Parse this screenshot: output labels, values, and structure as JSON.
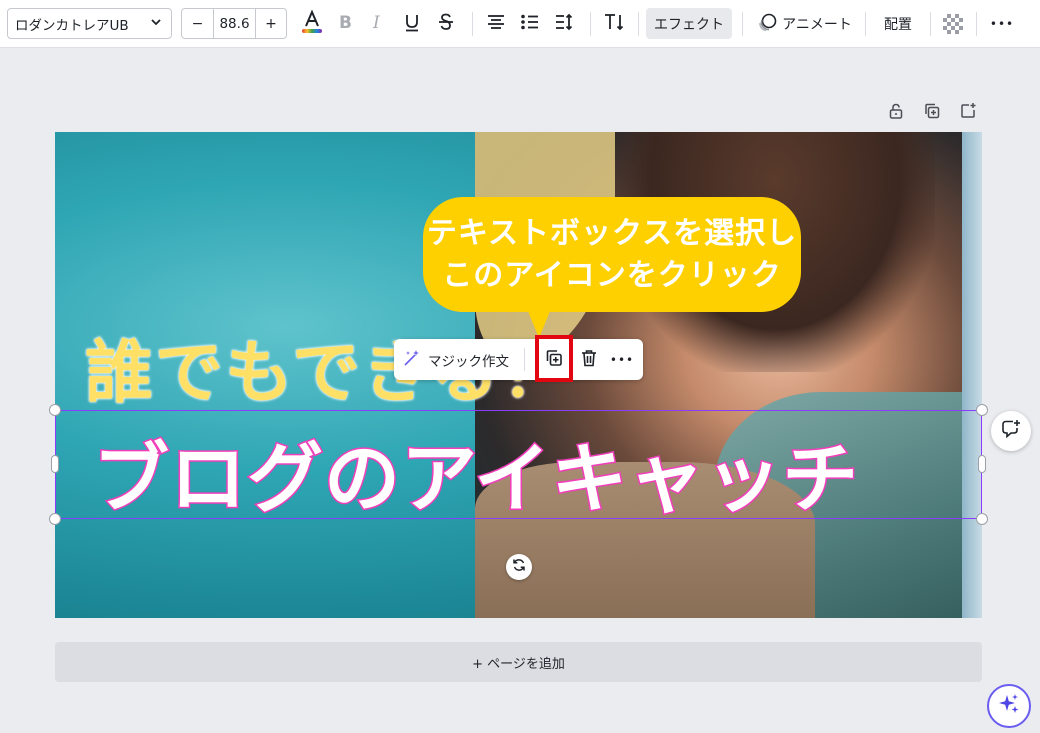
{
  "toolbar": {
    "font_name": "ロダンカトレアUB",
    "size_minus": "−",
    "font_size": "88.6",
    "size_plus": "+",
    "effect_label": "エフェクト",
    "animate_label": "アニメート",
    "arrange_label": "配置",
    "more_label": "•••"
  },
  "canvas": {
    "subtitle_text": "誰でもできる！",
    "title_text": "ブログのアイキャッチ",
    "bubble_line1": "テキストボックスを選択し",
    "bubble_line2": "このアイコンをクリック"
  },
  "context_toolbar": {
    "magic_write_label": "マジック作文",
    "more_label": "•••"
  },
  "add_page_label": "+ ページを追加",
  "colors": {
    "accent": "#8b3dff",
    "highlight": "#e1060f",
    "bubble": "#ffd000",
    "title_stroke": "#f13fbb",
    "subtitle": "#ffe066"
  }
}
